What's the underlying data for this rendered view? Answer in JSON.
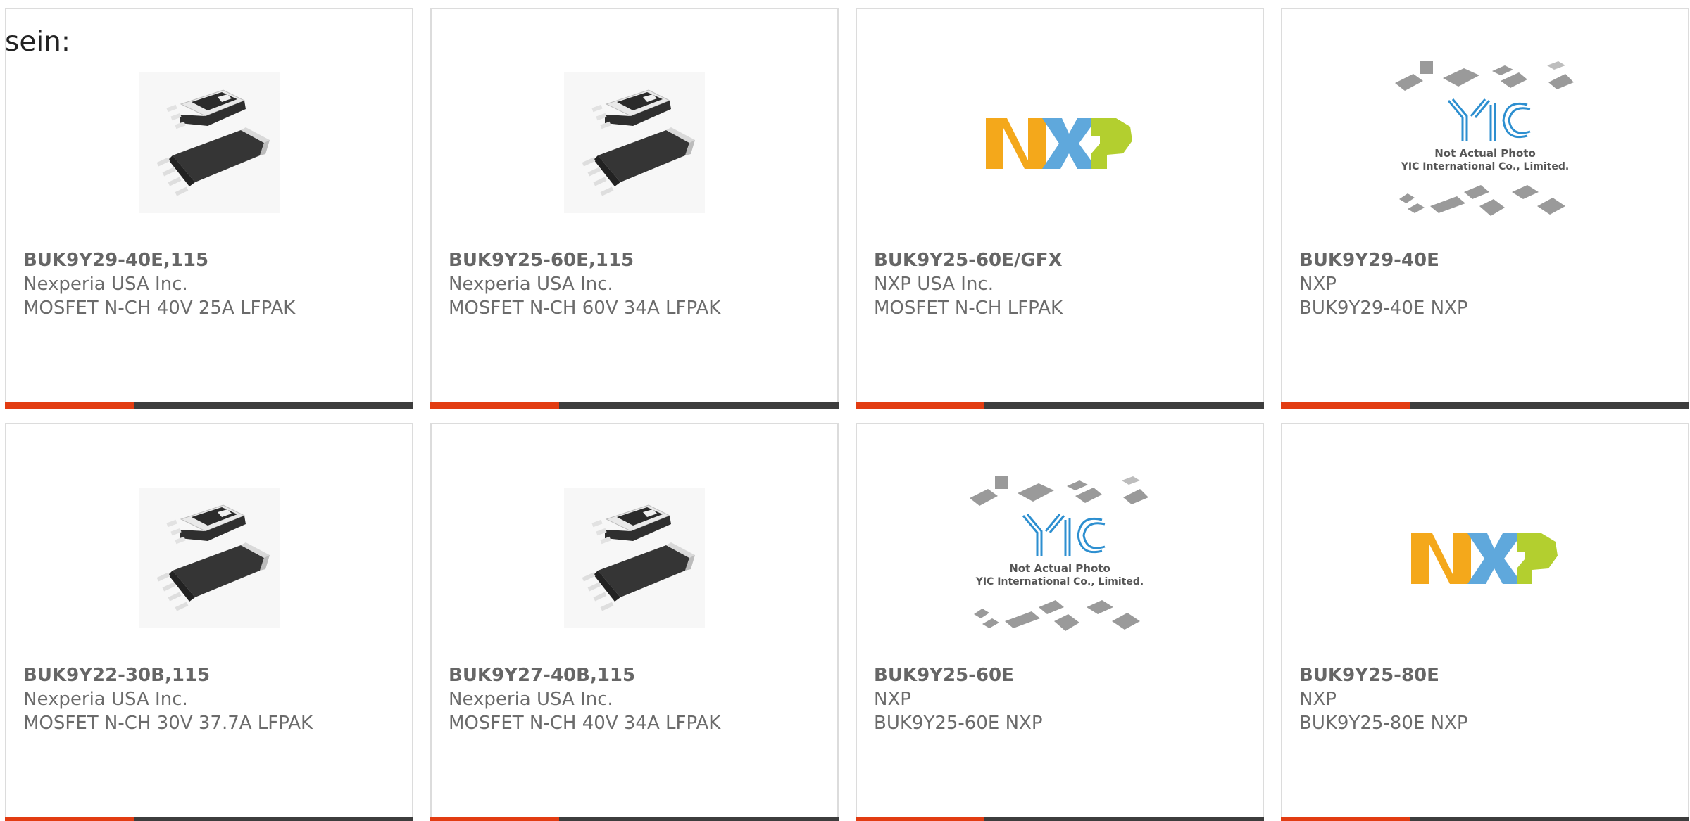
{
  "intro_text": "sein:",
  "colors": {
    "accent": "#e23c12",
    "bar": "#3d3d3d",
    "border": "#dcdcdc",
    "text": "#6b6b6b",
    "nxp_orange": "#f4a81b",
    "nxp_blue": "#5fa8dc",
    "nxp_green": "#b3cf2f",
    "yic_blue": "#2d8fd0"
  },
  "products": [
    {
      "part": "BUK9Y29-40E,115",
      "manufacturer": "Nexperia USA Inc.",
      "description": "MOSFET N-CH 40V 25A LFPAK",
      "image": "lfpak-chip"
    },
    {
      "part": "BUK9Y25-60E,115",
      "manufacturer": "Nexperia USA Inc.",
      "description": "MOSFET N-CH 60V 34A LFPAK",
      "image": "lfpak-chip"
    },
    {
      "part": "BUK9Y25-60E/GFX",
      "manufacturer": "NXP USA Inc.",
      "description": "MOSFET N-CH LFPAK",
      "image": "nxp-logo",
      "logo_letters": [
        "N",
        "X",
        "P"
      ]
    },
    {
      "part": "BUK9Y29-40E",
      "manufacturer": "NXP",
      "description": "BUK9Y29-40E NXP",
      "image": "not-actual-photo",
      "placeholder_lines": [
        "Not Actual Photo",
        "YIC International Co., Limited."
      ],
      "placeholder_logo": "YIC"
    },
    {
      "part": "BUK9Y22-30B,115",
      "manufacturer": "Nexperia USA Inc.",
      "description": "MOSFET N-CH 30V 37.7A LFPAK",
      "image": "lfpak-chip"
    },
    {
      "part": "BUK9Y27-40B,115",
      "manufacturer": "Nexperia USA Inc.",
      "description": "MOSFET N-CH 40V 34A LFPAK",
      "image": "lfpak-chip"
    },
    {
      "part": "BUK9Y25-60E",
      "manufacturer": "NXP",
      "description": "BUK9Y25-60E NXP",
      "image": "not-actual-photo",
      "placeholder_lines": [
        "Not Actual Photo",
        "YIC International Co., Limited."
      ],
      "placeholder_logo": "YIC"
    },
    {
      "part": "BUK9Y25-80E",
      "manufacturer": "NXP",
      "description": "BUK9Y25-80E NXP",
      "image": "nxp-logo",
      "logo_letters": [
        "N",
        "X",
        "P"
      ]
    }
  ]
}
